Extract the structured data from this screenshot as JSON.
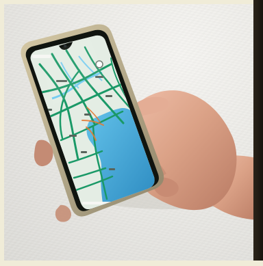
{
  "scene": {
    "subject": "",
    "colors": {
      "wall": "#ecebe7",
      "skin": "#d69d82",
      "phone_frame": "#b9b28f",
      "screen_land": "#e4ece4",
      "screen_water": "#42a9d8",
      "roads": "#1a9967",
      "highways": "#e37a36"
    }
  }
}
